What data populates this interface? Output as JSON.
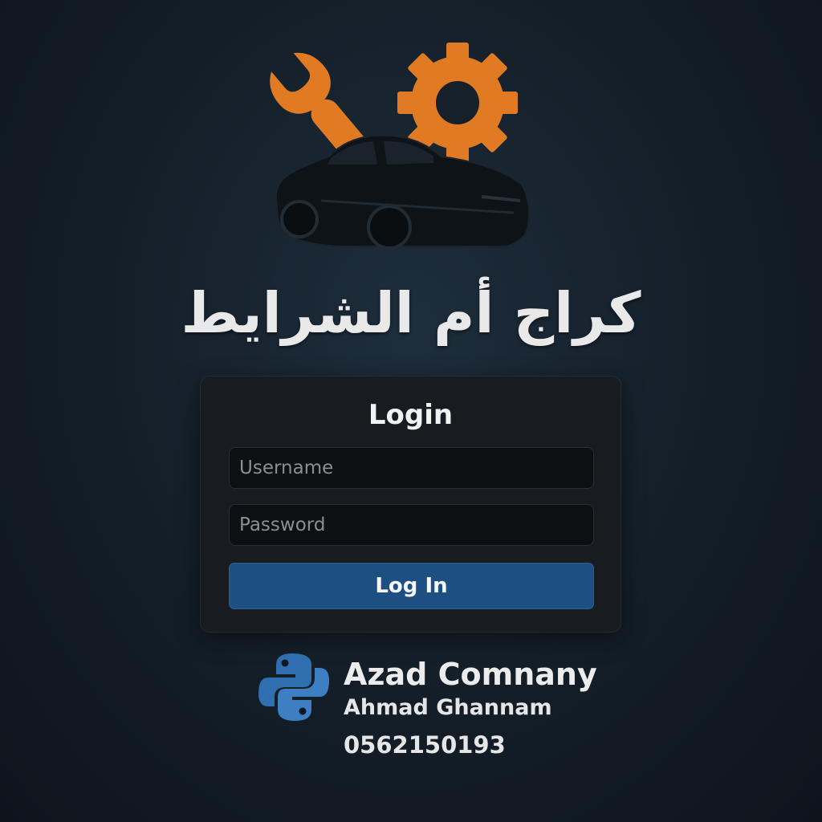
{
  "header": {
    "logo_icons": [
      "wrench-icon",
      "gear-icon",
      "car-icon"
    ],
    "brand_title": "كراج أم الشرايط"
  },
  "login": {
    "heading": "Login",
    "username_placeholder": "Username",
    "username_value": "",
    "password_placeholder": "Password",
    "password_value": "",
    "submit_label": "Log In"
  },
  "footer": {
    "logo_icon": "python-logo-icon",
    "company": "Azad Comnany",
    "person": "Ahmad Ghannam",
    "phone": "0562150193"
  },
  "colors": {
    "accent_orange": "#e07b24",
    "button_blue": "#1e4f82",
    "python_blue": "#2f6fb0",
    "card_bg": "#181c21"
  }
}
